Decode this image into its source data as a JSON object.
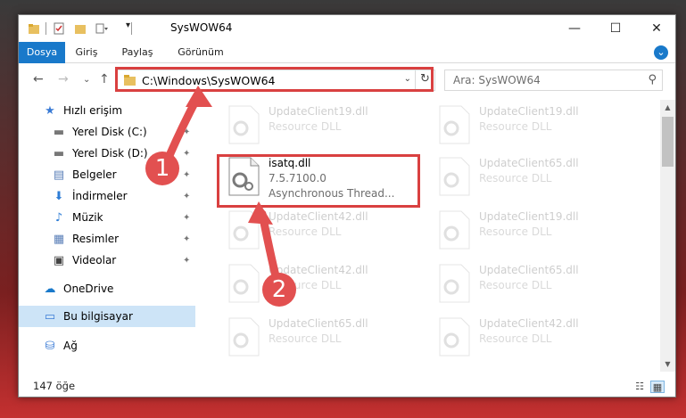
{
  "window": {
    "title": "SysWOW64",
    "minimize": "—",
    "maximize": "☐",
    "close": "✕"
  },
  "ribbon": {
    "tabs": [
      "Dosya",
      "Giriş",
      "Paylaş",
      "Görünüm"
    ],
    "expand": "⌄"
  },
  "nav": {
    "back": "←",
    "forward": "→",
    "recent": "⌄",
    "up": "↑",
    "address": "C:\\Windows\\SysWOW64",
    "address_dropdown": "⌄",
    "refresh": "↻",
    "search_placeholder": "Ara: SysWOW64",
    "search_icon": "⚲"
  },
  "sidebar": {
    "items": [
      {
        "label": "Hızlı erişim",
        "icon": "star-icon",
        "glyph": "★",
        "pinned": false
      },
      {
        "label": "Yerel Disk (C:)",
        "icon": "drive-icon",
        "glyph": "▬",
        "pinned": true
      },
      {
        "label": "Yerel Disk (D:)",
        "icon": "drive-icon",
        "glyph": "▬",
        "pinned": true
      },
      {
        "label": "Belgeler",
        "icon": "documents-icon",
        "glyph": "▤",
        "pinned": true
      },
      {
        "label": "İndirmeler",
        "icon": "download-icon",
        "glyph": "⬇",
        "pinned": true
      },
      {
        "label": "Müzik",
        "icon": "music-icon",
        "glyph": "♪",
        "pinned": true
      },
      {
        "label": "Resimler",
        "icon": "pictures-icon",
        "glyph": "▦",
        "pinned": true
      },
      {
        "label": "Videolar",
        "icon": "videos-icon",
        "glyph": "▣",
        "pinned": true
      },
      {
        "label": "OneDrive",
        "icon": "cloud-icon",
        "glyph": "☁",
        "pinned": false
      },
      {
        "label": "Bu bilgisayar",
        "icon": "computer-icon",
        "glyph": "▭",
        "pinned": false
      },
      {
        "label": "Ağ",
        "icon": "network-icon",
        "glyph": "⛁",
        "pinned": false
      }
    ],
    "pin_glyph": "📌"
  },
  "files": {
    "highlighted": {
      "name": "isatq.dll",
      "version": "7.5.7100.0",
      "description": "Asynchronous Thread..."
    },
    "faded": [
      {
        "name": "UpdateClient19.dll",
        "description": "Resource DLL"
      },
      {
        "name": "UpdateClient19.dll",
        "description": "Resource DLL"
      },
      {
        "name": "UpdateClient65.dll",
        "description": "Resource DLL"
      },
      {
        "name": "UpdateClient42.dll",
        "description": "Resource DLL"
      },
      {
        "name": "UpdateClient19.dll",
        "description": "Resource DLL"
      },
      {
        "name": "UpdateClient42.dll",
        "description": "Resource DLL"
      },
      {
        "name": "UpdateClient65.dll",
        "description": "Resource DLL"
      },
      {
        "name": "UpdateClient65.dll",
        "description": "Resource DLL"
      },
      {
        "name": "UpdateClient42.dll",
        "description": "Resource DLL"
      }
    ]
  },
  "status": {
    "count": "147 öğe"
  },
  "annotations": {
    "step1": "1",
    "step2": "2",
    "color": "#e25050"
  },
  "colors": {
    "accent": "#1979ca",
    "highlight_border": "#d94040",
    "selection": "#cde4f7"
  }
}
